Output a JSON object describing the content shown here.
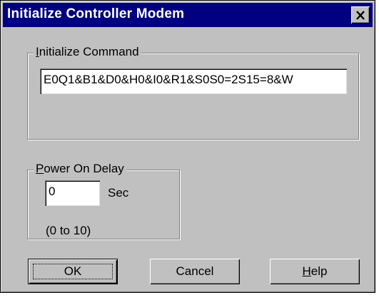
{
  "window": {
    "title": "Initialize Controller Modem",
    "close_glyph": "✕",
    "close_icon": "close-icon"
  },
  "init_group": {
    "label_prefix": "",
    "label_accel": "I",
    "label_rest": "nitialize Command",
    "command_value": "E0Q1&B1&D0&H0&I0&R1&S0S0=2S15=8&W"
  },
  "power_group": {
    "label_accel": "P",
    "label_rest": "ower On Delay",
    "delay_value": "0",
    "unit": "Sec",
    "range_hint": "(0 to 10)"
  },
  "buttons": {
    "ok": "OK",
    "cancel": "Cancel",
    "help_accel": "H",
    "help_rest": "elp"
  },
  "colors": {
    "title_bar": "#000080",
    "face": "#c0c0c0"
  }
}
